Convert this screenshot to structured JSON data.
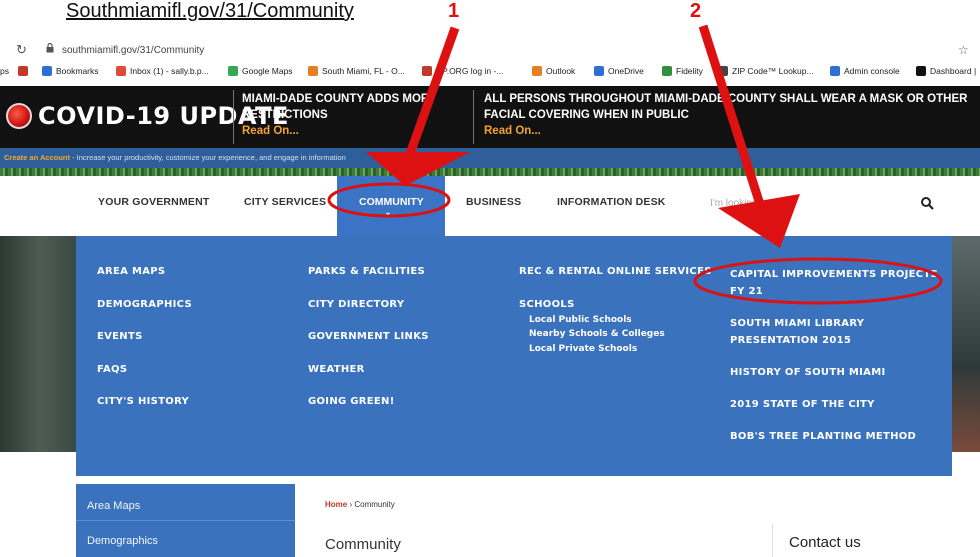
{
  "caption": "Southmiamifl.gov/31/Community",
  "browser": {
    "url": "southmiamifl.gov/31/Community",
    "bookmarks": [
      {
        "label": "ps",
        "color": "#999999"
      },
      {
        "label": "",
        "color": "#c0392b"
      },
      {
        "label": "Bookmarks",
        "color": "#2e6fd6"
      },
      {
        "label": "Inbox (1) - sally.b.p...",
        "color": "#dd4b39"
      },
      {
        "label": "Google Maps",
        "color": "#34a853"
      },
      {
        "label": "South Miami, FL - O...",
        "color": "#e67e22"
      },
      {
        "label": "RP.ORG log in -...",
        "color": "#c0392b"
      },
      {
        "label": "Outlook",
        "color": "#e67e22"
      },
      {
        "label": "OneDrive",
        "color": "#2e6fd6"
      },
      {
        "label": "Fidelity",
        "color": "#2f8f3a"
      },
      {
        "label": "ZIP Code™ Lookup...",
        "color": "#444444"
      },
      {
        "label": "Admin console",
        "color": "#2e6fd6"
      },
      {
        "label": "Dashboard |",
        "color": "#111111"
      }
    ]
  },
  "covid": {
    "title": "COVID-19 UPDATE",
    "alert1": "MIAMI-DADE COUNTY ADDS MOF RESTRICTIONS",
    "alert2": "ALL PERSONS THROUGHOUT MIAMI-DADE COUNTY SHALL WEAR A MASK OR OTHER FACIAL COVERING WHEN IN PUBLIC",
    "read_on": "Read On..."
  },
  "account_bar": {
    "create": "Create an Account",
    "text": " - Increase your productivity, customize your experience, and engage in information"
  },
  "nav": {
    "items": [
      "YOUR GOVERNMENT",
      "CITY SERVICES",
      "COMMUNITY",
      "BUSINESS",
      "INFORMATION DESK"
    ],
    "search_placeholder": "I'm looking for..."
  },
  "menu": {
    "col1": [
      "AREA MAPS",
      "DEMOGRAPHICS",
      "EVENTS",
      "FAQS",
      "CITY'S HISTORY"
    ],
    "col2": [
      "PARKS & FACILITIES",
      "CITY DIRECTORY",
      "GOVERNMENT LINKS",
      "WEATHER",
      "GOING GREEN!"
    ],
    "col3_top": "REC & RENTAL ONLINE SERVICES",
    "col3_schools": "SCHOOLS",
    "col3_subs": [
      "Local Public Schools",
      "Nearby Schools & Colleges",
      "Local Private Schools"
    ],
    "col4": [
      "CAPITAL IMPROVEMENTS PROJECTS FY 21",
      "SOUTH MIAMI LIBRARY PRESENTATION 2015",
      "HISTORY OF SOUTH MIAMI",
      "2019 STATE OF THE CITY",
      "BOB'S TREE PLANTING METHOD"
    ]
  },
  "sidebar": [
    "Area Maps",
    "Demographics"
  ],
  "breadcrumb": {
    "home": "Home",
    "sep": " › ",
    "current": "Community"
  },
  "page_title": "Community",
  "contact": "Contact us",
  "annotations": {
    "one": "1",
    "two": "2",
    "color": "#dd1111"
  }
}
